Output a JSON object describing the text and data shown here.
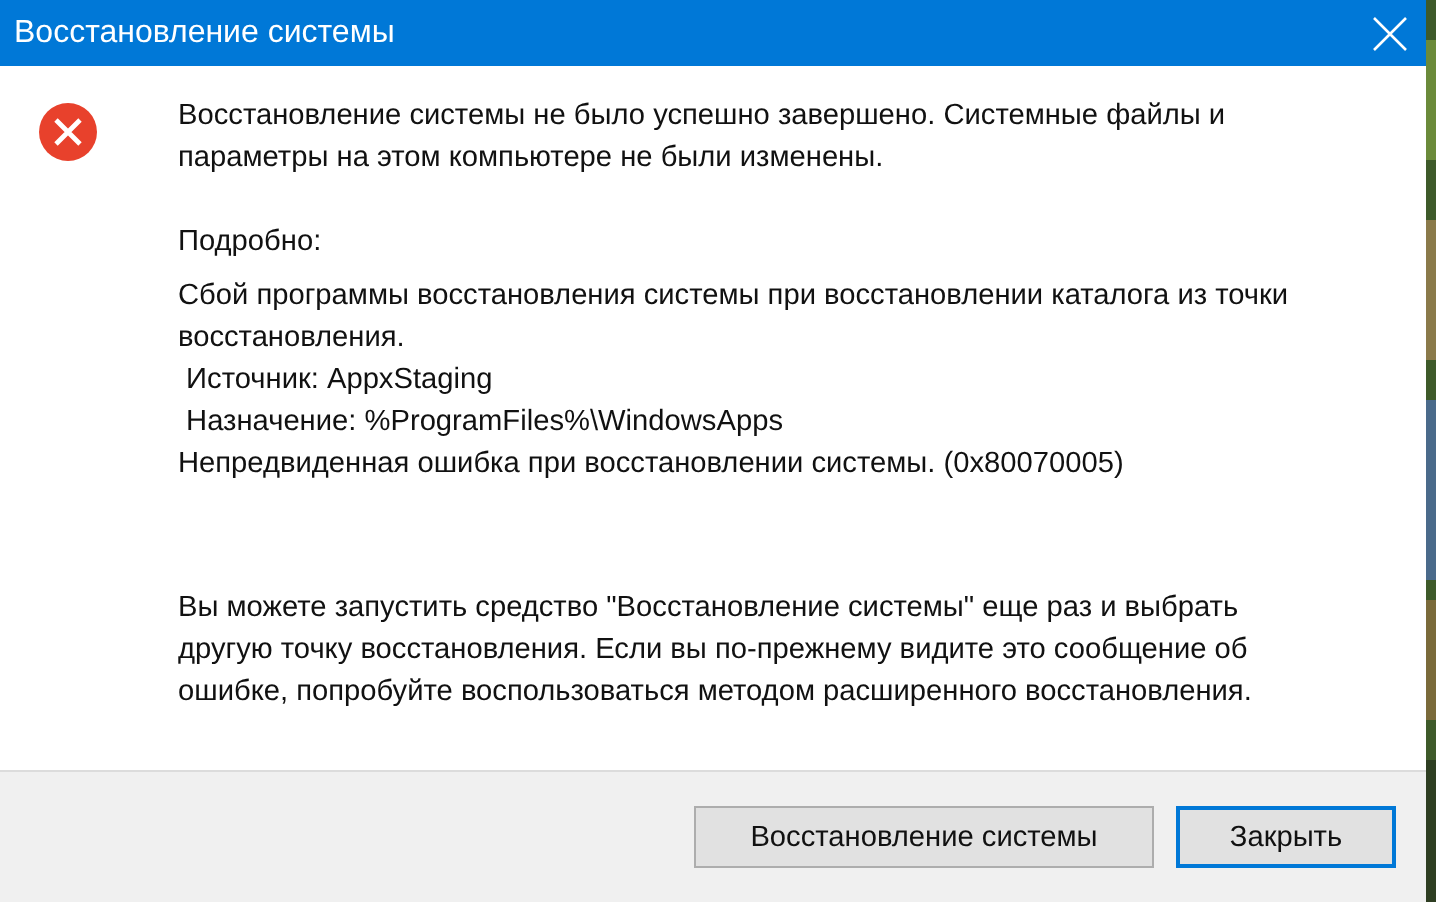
{
  "window": {
    "title": "Восстановление системы"
  },
  "message": [
    "Восстановление системы не было успешно завершено. Системные файлы и",
    "параметры на этом компьютере не были изменены."
  ],
  "details_label": "Подробно:",
  "details": [
    "Сбой программы восстановления системы при восстановлении каталога из точки",
    "восстановления.",
    " Источник: AppxStaging",
    " Назначение: %ProgramFiles%\\WindowsApps",
    "Непредвиденная ошибка при восстановлении системы. (0x80070005)"
  ],
  "hint": [
    "Вы можете запустить средство \"Восстановление системы\" еще раз и выбрать",
    "другую точку восстановления. Если вы по-прежнему видите это сообщение об",
    "ошибке, попробуйте воспользоваться методом расширенного восстановления."
  ],
  "buttons": [
    {
      "label": "Восстановление системы",
      "default": false
    },
    {
      "label": "Закрыть",
      "default": true
    }
  ]
}
